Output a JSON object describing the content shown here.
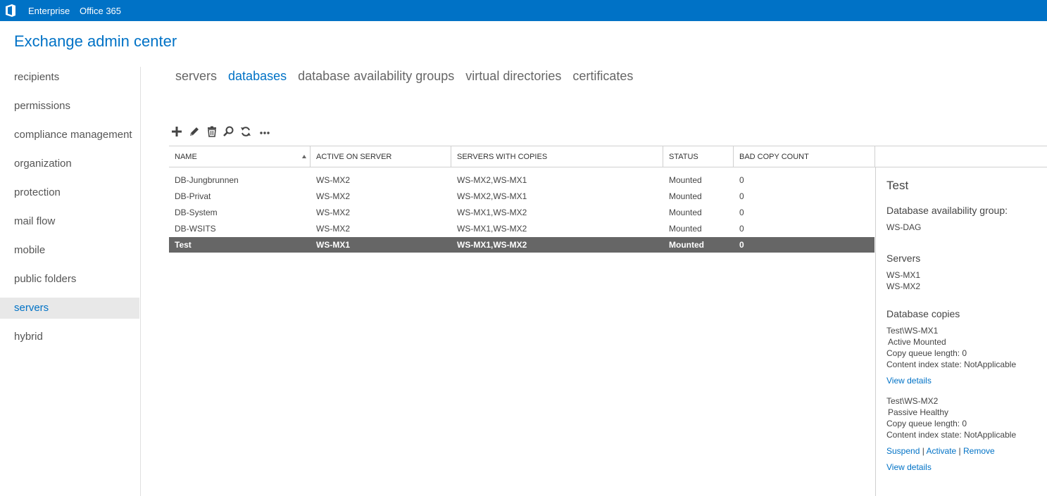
{
  "topbar": {
    "enterprise": "Enterprise",
    "office365": "Office 365"
  },
  "app_title": "Exchange admin center",
  "nav": [
    "recipients",
    "permissions",
    "compliance management",
    "organization",
    "protection",
    "mail flow",
    "mobile",
    "public folders",
    "servers",
    "hybrid"
  ],
  "nav_selected": "servers",
  "tabs": [
    "servers",
    "databases",
    "database availability groups",
    "virtual directories",
    "certificates"
  ],
  "active_tab": "databases",
  "toolbar_icons": [
    "add-icon",
    "edit-icon",
    "delete-icon",
    "search-icon",
    "refresh-icon",
    "more-icon"
  ],
  "table": {
    "columns": [
      "NAME",
      "ACTIVE ON SERVER",
      "SERVERS WITH COPIES",
      "STATUS",
      "BAD COPY COUNT"
    ],
    "rows": [
      [
        "DB-Jungbrunnen",
        "WS-MX2",
        "WS-MX2,WS-MX1",
        "Mounted",
        "0"
      ],
      [
        "DB-Privat",
        "WS-MX2",
        "WS-MX2,WS-MX1",
        "Mounted",
        "0"
      ],
      [
        "DB-System",
        "WS-MX2",
        "WS-MX1,WS-MX2",
        "Mounted",
        "0"
      ],
      [
        "DB-WSITS",
        "WS-MX2",
        "WS-MX1,WS-MX2",
        "Mounted",
        "0"
      ],
      [
        "Test",
        "WS-MX1",
        "WS-MX1,WS-MX2",
        "Mounted",
        "0"
      ]
    ],
    "selected_row": "Test"
  },
  "details": {
    "title": "Test",
    "dag_label": "Database availability group:",
    "dag_value": "WS-DAG",
    "servers_label": "Servers",
    "servers": [
      "WS-MX1",
      "WS-MX2"
    ],
    "copies_label": "Database copies",
    "copy1": {
      "name": "Test\\WS-MX1",
      "state": "Active Mounted",
      "queue": "Copy queue length:  0",
      "index": "Content index state:  NotApplicable",
      "view_details": "View details"
    },
    "copy2": {
      "name": "Test\\WS-MX2",
      "state": "Passive Healthy",
      "queue": "Copy queue length:  0",
      "index": "Content index state:  NotApplicable",
      "suspend": "Suspend",
      "activate": "Activate",
      "remove": "Remove",
      "separator": "|",
      "view_details": "View details"
    }
  },
  "colors": {
    "accent": "#0072c6",
    "selected_row": "#666666",
    "nav_selected_bg": "#e8e8e8"
  }
}
